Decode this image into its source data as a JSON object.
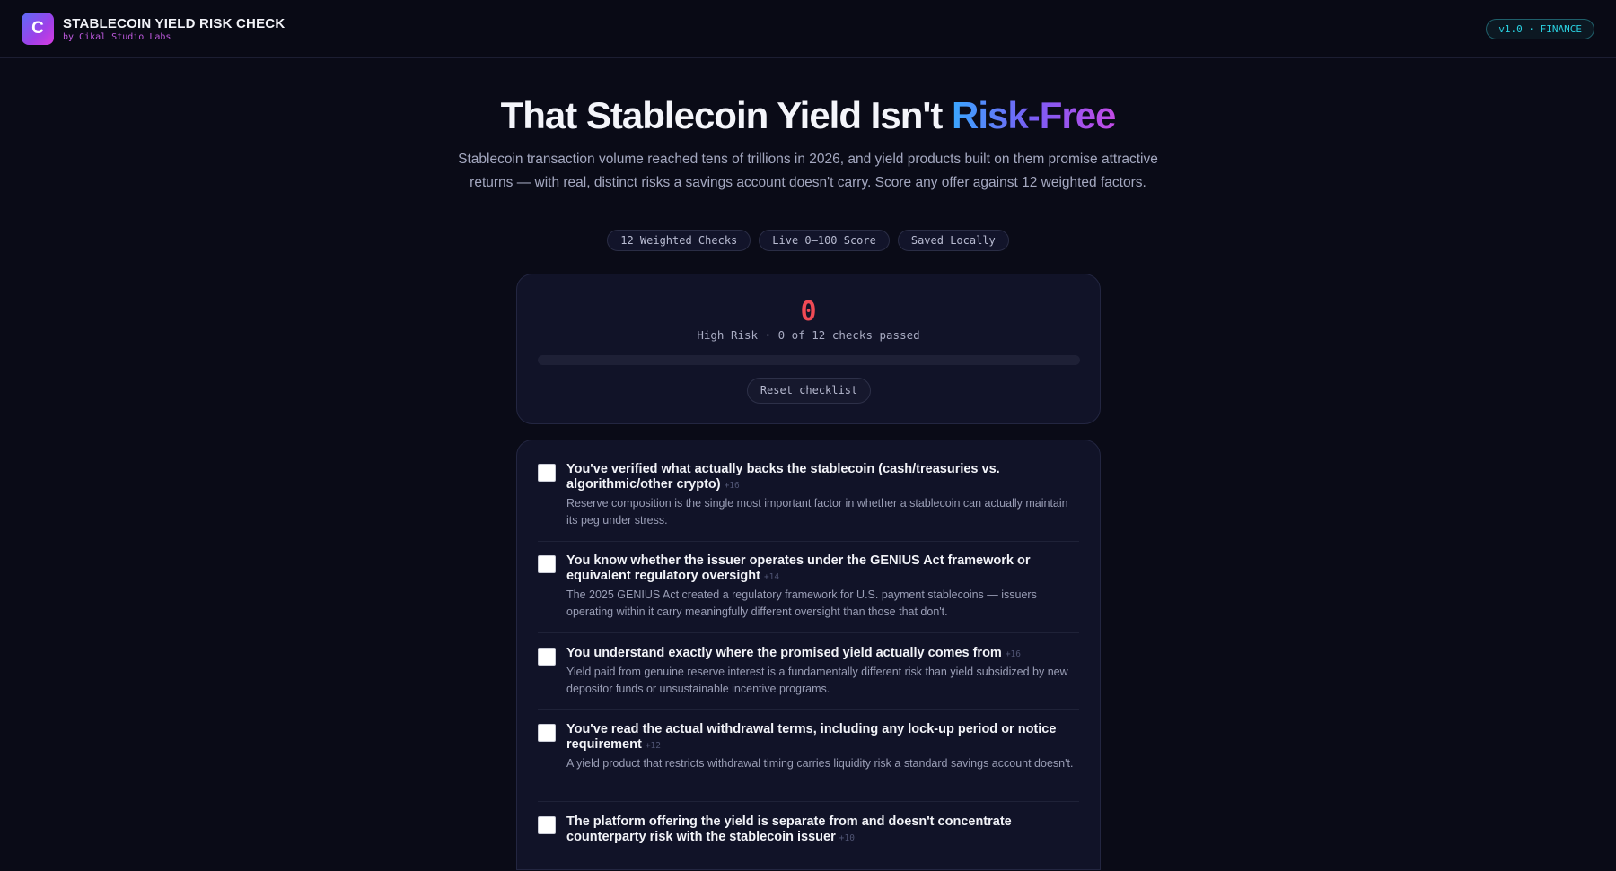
{
  "header": {
    "logo_letter": "C",
    "title": "STABLECOIN YIELD RISK CHECK",
    "subtitle": "by Cikal Studio Labs",
    "version_badge": "v1.0 · FINANCE"
  },
  "hero": {
    "title_main": "That Stablecoin Yield Isn't ",
    "title_accent": "Risk-Free",
    "description": "Stablecoin transaction volume reached tens of trillions in 2026, and yield products built on them promise attractive returns — with real, distinct risks a savings account doesn't carry. Score any offer against 12 weighted factors.",
    "chips": [
      "12 Weighted Checks",
      "Live 0–100 Score",
      "Saved Locally"
    ]
  },
  "score": {
    "value": "0",
    "status": "High Risk · 0 of 12 checks passed",
    "progress_fraction": 0,
    "reset_label": "Reset checklist",
    "color": "#f04a55"
  },
  "checklist": {
    "items": [
      {
        "title": "You've verified what actually backs the stablecoin (cash/treasuries vs. algorithmic/other crypto)",
        "weight": "+16",
        "desc": "Reserve composition is the single most important factor in whether a stablecoin can actually maintain its peg under stress.",
        "checked": false
      },
      {
        "title": "You know whether the issuer operates under the GENIUS Act framework or equivalent regulatory oversight",
        "weight": "+14",
        "desc": "The 2025 GENIUS Act created a regulatory framework for U.S. payment stablecoins — issuers operating within it carry meaningfully different oversight than those that don't.",
        "checked": false
      },
      {
        "title": "You understand exactly where the promised yield actually comes from",
        "weight": "+16",
        "desc": "Yield paid from genuine reserve interest is a fundamentally different risk than yield subsidized by new depositor funds or unsustainable incentive programs.",
        "checked": false
      },
      {
        "title": "You've read the actual withdrawal terms, including any lock-up period or notice requirement",
        "weight": "+12",
        "desc": "A yield product that restricts withdrawal timing carries liquidity risk a standard savings account doesn't.",
        "checked": false
      },
      {
        "title": "The platform offering the yield is separate from and doesn't concentrate counterparty risk with the stablecoin issuer",
        "weight": "+10",
        "desc": "",
        "checked": false
      }
    ]
  }
}
